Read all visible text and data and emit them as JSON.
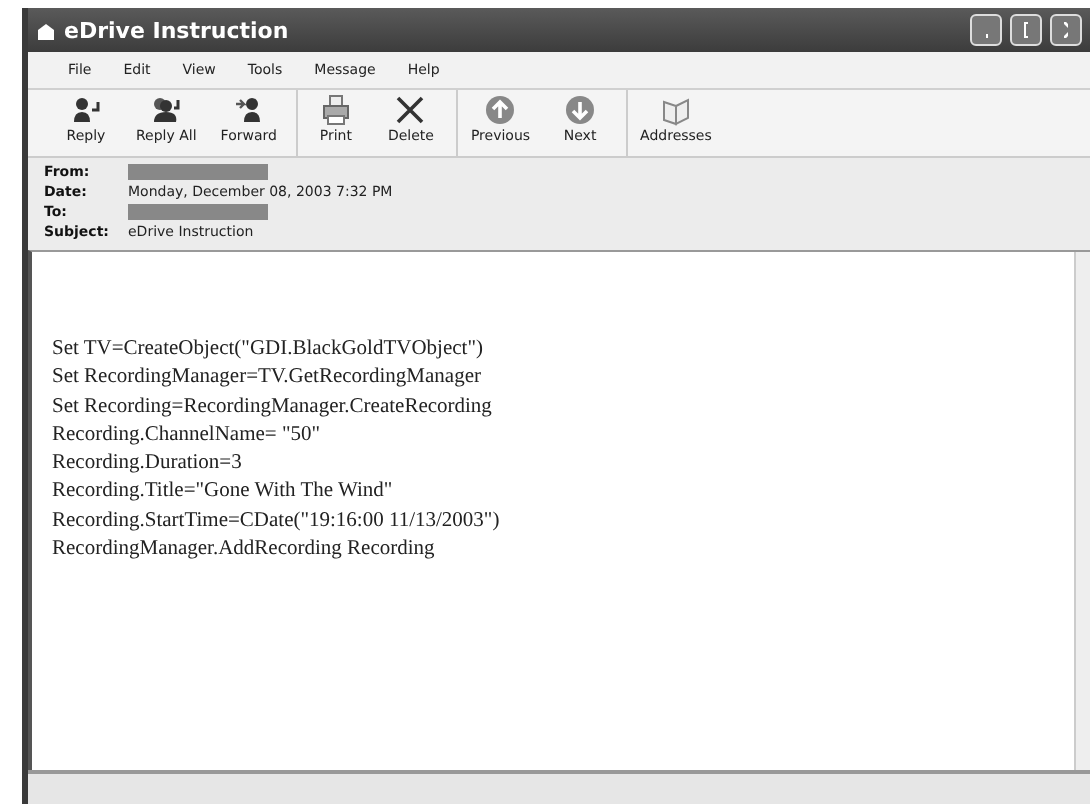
{
  "window": {
    "title": "eDrive Instruction"
  },
  "menu": [
    "File",
    "Edit",
    "View",
    "Tools",
    "Message",
    "Help"
  ],
  "toolbar": [
    {
      "label": "Reply",
      "kind": "reply",
      "group_start": false
    },
    {
      "label": "Reply All",
      "kind": "replyall",
      "group_start": false
    },
    {
      "label": "Forward",
      "kind": "forward",
      "group_start": false
    },
    {
      "label": "Print",
      "kind": "print",
      "group_start": true
    },
    {
      "label": "Delete",
      "kind": "delete",
      "group_start": false
    },
    {
      "label": "Previous",
      "kind": "previous",
      "group_start": true
    },
    {
      "label": "Next",
      "kind": "next",
      "group_start": false
    },
    {
      "label": "Addresses",
      "kind": "addresses",
      "group_start": true
    }
  ],
  "headers": [
    {
      "label": "From:",
      "kind": "redacted"
    },
    {
      "label": "Date:",
      "kind": "text",
      "value": "Monday, December 08, 2003 7:32 PM"
    },
    {
      "label": "To:",
      "kind": "redacted"
    },
    {
      "label": "Subject:",
      "kind": "text",
      "value": "eDrive Instruction"
    }
  ],
  "body_lines": [
    "Set TV=CreateObject(\"GDI.BlackGoldTVObject\")",
    "Set RecordingManager=TV.GetRecordingManager",
    "Set Recording=RecordingManager.CreateRecording",
    "Recording.ChannelName= \"50\"",
    "Recording.Duration=3",
    "Recording.Title=\"Gone With The Wind\"",
    "Recording.StartTime=CDate(\"19:16:00 11/13/2003\")",
    "RecordingManager.AddRecording Recording"
  ]
}
